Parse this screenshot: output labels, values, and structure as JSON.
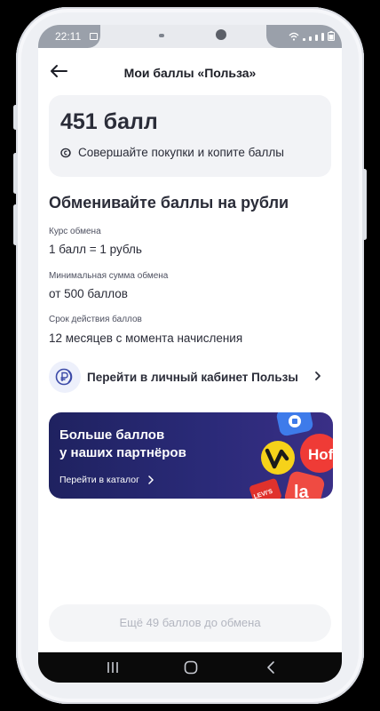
{
  "status_bar": {
    "time": "22:11"
  },
  "header": {
    "title": "Мои баллы «Польза»"
  },
  "balance": {
    "points": "451 балл",
    "hint": "Совершайте покупки и копите баллы"
  },
  "exchange": {
    "heading": "Обменивайте баллы на рубли",
    "rate_label": "Курс обмена",
    "rate_value": "1 балл = 1 рубль",
    "min_label": "Минимальная сумма обмена",
    "min_value": "от 500 баллов",
    "validity_label": "Срок действия баллов",
    "validity_value": "12 месяцев с момента начисления"
  },
  "cabinet_link": {
    "label": "Перейти в личный кабинет Пользы"
  },
  "banner": {
    "title_line1": "Больше баллов",
    "title_line2": "у наших партнёров",
    "link": "Перейти в каталог",
    "partner_logos": [
      "Hoff",
      "la",
      "LEVI'S"
    ]
  },
  "bottom_button": {
    "label": "Ещё 49 баллов до обмена"
  },
  "colors": {
    "accent": "#2a2a78",
    "text": "#2a2c38",
    "yellow": "#f6d21a",
    "red": "#ef3b36"
  }
}
